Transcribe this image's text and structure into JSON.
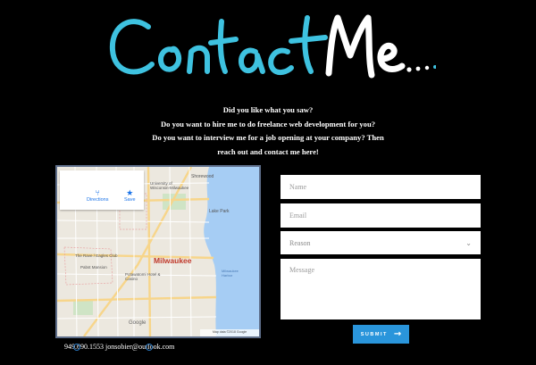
{
  "header": {
    "title_part1": "Contact",
    "title_part2": "Me"
  },
  "intro": {
    "line1": "Did you like what you saw?",
    "line2": "Do you want to hire me to do freelance web development for you?",
    "line3": "Do you want to interview me for a job opening at your company? Then",
    "line4": "reach out and contact me here!"
  },
  "map": {
    "card_directions": "Directions",
    "card_save": "Save",
    "city_label": "Milwaukee",
    "place_labels": [
      "Shorewood",
      "University of Wisconsin-Milwaukee",
      "Lake Park",
      "The Rave / Eagles Club",
      "Pabst Mansion",
      "Potawatomi Hotel & Casino",
      "Milwaukee Harbor"
    ],
    "footer_label": "Map data ©2018 Google",
    "google_label": "Google"
  },
  "contact": {
    "phone": "949.690.1553",
    "email": "jonsobier@outlook.com"
  },
  "form": {
    "name_placeholder": "Name",
    "email_placeholder": "Email",
    "reason_placeholder": "Reason",
    "message_placeholder": "Message",
    "submit_label": "SUBMIT"
  },
  "colors": {
    "title_cyan": "#3ec2e0",
    "title_white": "#ffffff",
    "submit_blue": "#2a95db"
  }
}
